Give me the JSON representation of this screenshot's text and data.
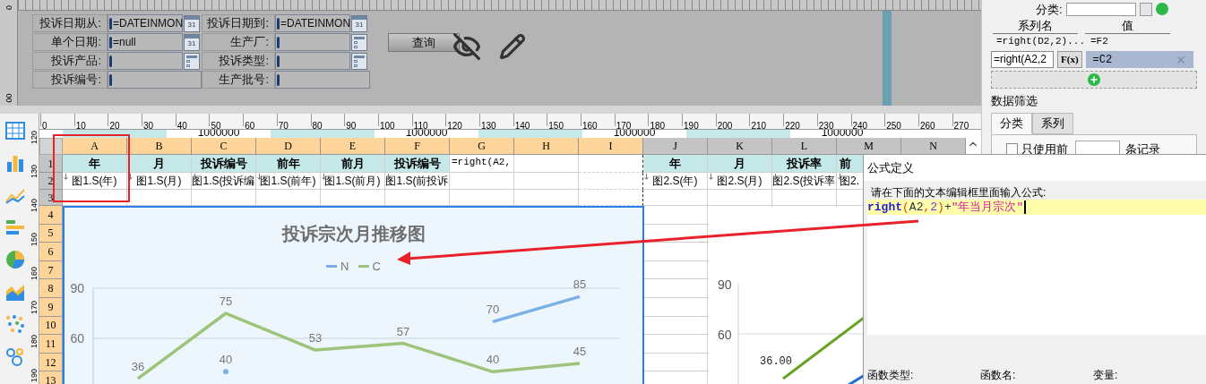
{
  "designer": {
    "ruler_labels": [
      "0",
      "00"
    ],
    "fields": [
      {
        "label": "投诉日期从:",
        "value": "=DATEINMON",
        "kind": "calendar",
        "picker_text": "31"
      },
      {
        "label": "投诉日期到:",
        "value": "=DATEINMON",
        "kind": "calendar",
        "picker_text": "31"
      },
      {
        "label": "单个日期:",
        "value": "=null",
        "kind": "calendar",
        "picker_text": "31"
      },
      {
        "label": "生产厂:",
        "kind": "dropdown"
      },
      {
        "label": "投诉产品:",
        "kind": "dropdown"
      },
      {
        "label": "投诉类型:",
        "kind": "dropdown"
      },
      {
        "label": "投诉编号:",
        "kind": "text"
      },
      {
        "label": "生产批号:",
        "kind": "text"
      }
    ],
    "query_button": "查询"
  },
  "sheet": {
    "x_ruler": [
      "0",
      "10",
      "20",
      "30",
      "40",
      "50",
      "60",
      "70",
      "80",
      "90",
      "100",
      "110",
      "120",
      "130",
      "140",
      "150",
      "160",
      "170",
      "180",
      "190",
      "200",
      "210",
      "220",
      "230",
      "240",
      "250",
      "260",
      "270"
    ],
    "y_ruler": [
      "120",
      "130",
      "140",
      "150",
      "160",
      "170",
      "180",
      "190"
    ],
    "partial_row": [
      {
        "shaded": true
      },
      {
        "text": "1000000"
      },
      {
        "shaded": true
      },
      {
        "text": "1000000"
      },
      {
        "shaded": true
      },
      {
        "text": "1000000"
      },
      {
        "shaded": true
      },
      {
        "text": "1000000"
      }
    ],
    "columns": [
      {
        "letter": "A",
        "in_range": true
      },
      {
        "letter": "B",
        "in_range": true
      },
      {
        "letter": "C",
        "in_range": true
      },
      {
        "letter": "D",
        "in_range": true
      },
      {
        "letter": "E",
        "in_range": true
      },
      {
        "letter": "F",
        "in_range": true
      },
      {
        "letter": "G",
        "in_range": true
      },
      {
        "letter": "H",
        "in_range": true
      },
      {
        "letter": "I",
        "in_range": true
      },
      {
        "letter": "J",
        "in_range": false
      },
      {
        "letter": "K",
        "in_range": false
      },
      {
        "letter": "L",
        "in_range": false
      },
      {
        "letter": "M",
        "in_range": false
      },
      {
        "letter": "N",
        "in_range": false
      }
    ],
    "rows": [
      {
        "number": "1",
        "in_range": false,
        "cells": [
          {
            "kind": "header",
            "text": "年"
          },
          {
            "kind": "header",
            "text": "月"
          },
          {
            "kind": "header",
            "text": "投诉编号"
          },
          {
            "kind": "header",
            "text": "前年"
          },
          {
            "kind": "header",
            "text": "前月"
          },
          {
            "kind": "header",
            "text": "投诉编号"
          },
          {
            "kind": "formula",
            "text": "=right(A2,"
          },
          {
            "kind": "plain"
          },
          {
            "kind": "plain"
          },
          {
            "kind": "header",
            "text": "年"
          },
          {
            "kind": "header",
            "text": "月"
          },
          {
            "kind": "header",
            "text": "投诉率"
          },
          {
            "kind": "header",
            "text": "前"
          },
          {
            "kind": "plain"
          }
        ]
      },
      {
        "number": "2",
        "in_range": false,
        "cells": [
          {
            "kind": "data",
            "text": "图1.S(年)",
            "expand": true
          },
          {
            "kind": "data",
            "text": "图1.S(月)",
            "expand": true
          },
          {
            "kind": "data",
            "text": "图1.S(投诉编",
            "expand": true
          },
          {
            "kind": "data",
            "text": "图1.S(前年)",
            "expand": true
          },
          {
            "kind": "data",
            "text": "图1.S(前月)",
            "expand": true
          },
          {
            "kind": "data",
            "text": "图1.S(前投诉",
            "expand": true
          },
          {
            "kind": "plain"
          },
          {
            "kind": "plain"
          },
          {
            "kind": "plain"
          },
          {
            "kind": "data",
            "text": "图2.S(年)",
            "expand": true
          },
          {
            "kind": "data",
            "text": "图2.S(月)",
            "expand": true
          },
          {
            "kind": "data",
            "text": "图2.S(投诉率",
            "expand": true
          },
          {
            "kind": "data",
            "text": "图2.",
            "expand": true
          },
          {
            "kind": "plain"
          }
        ]
      },
      {
        "number": "3",
        "in_range": false,
        "cells": []
      },
      {
        "number": "4",
        "in_range": true,
        "cells": []
      },
      {
        "number": "5",
        "in_range": true,
        "cells": []
      },
      {
        "number": "6",
        "in_range": true,
        "cells": []
      },
      {
        "number": "7",
        "in_range": true,
        "cells": []
      },
      {
        "number": "8",
        "in_range": true,
        "cells": []
      },
      {
        "number": "9",
        "in_range": true,
        "cells": []
      },
      {
        "number": "10",
        "in_range": true,
        "cells": []
      },
      {
        "number": "11",
        "in_range": true,
        "cells": []
      },
      {
        "number": "12",
        "in_range": true,
        "cells": []
      },
      {
        "number": "13",
        "in_range": true,
        "cells": []
      }
    ],
    "charts": [
      {
        "title": "投诉宗次月推移图",
        "chart_data": {
          "type": "line",
          "ylim": [
            30,
            90
          ],
          "yticks": [
            {
              "value": 60,
              "label": "60"
            },
            {
              "value": 90,
              "label": "90"
            }
          ],
          "series": [
            {
              "name": "N",
              "color": "#7ab0e6",
              "values": [
                null,
                40,
                null,
                null,
                70,
                85
              ]
            },
            {
              "name": "C",
              "color": "#9dc47a",
              "values": [
                36,
                75,
                53,
                57,
                40,
                45
              ]
            }
          ],
          "value_labels": [
            [
              null,
              "40",
              null,
              null,
              "70",
              "85"
            ],
            [
              "36",
              "75",
              "53",
              "57",
              "40",
              "45"
            ]
          ]
        }
      }
    ],
    "chart_picture": {
      "y_labels": [
        "90",
        "60"
      ],
      "point_label": "36.00"
    }
  },
  "panel": {
    "category_label": "分类:",
    "series_table": {
      "columns": [
        "系列名",
        "值"
      ],
      "rows": [
        {
          "name": "=right(D2,2)...",
          "value": "=F2",
          "selected": false
        },
        {
          "name": "=right(A2,2",
          "value": "=C2",
          "selected": true
        }
      ]
    },
    "fx_label": "F(x)",
    "filter_title": "数据筛选",
    "tabs": [
      {
        "label": "分类",
        "selected": true
      },
      {
        "label": "系列",
        "selected": false
      }
    ],
    "use_first": {
      "checked": false,
      "label": "只使用前",
      "suffix": "条记录"
    }
  },
  "dialog": {
    "title": "公式定义",
    "prompt": "请在下面的文本编辑框里面输入公式:",
    "formula": [
      {
        "kind": "function",
        "text": "right"
      },
      {
        "kind": "paren",
        "text": "("
      },
      {
        "kind": "ref",
        "text": "A2"
      },
      {
        "kind": "comma",
        "text": ","
      },
      {
        "kind": "number",
        "text": "2"
      },
      {
        "kind": "paren",
        "text": ")"
      },
      {
        "kind": "operator",
        "text": "+"
      },
      {
        "kind": "string",
        "text": "\"年当月宗次\""
      }
    ],
    "footer_labels": [
      "函数类型:",
      "函数名:",
      "变量:"
    ]
  }
}
